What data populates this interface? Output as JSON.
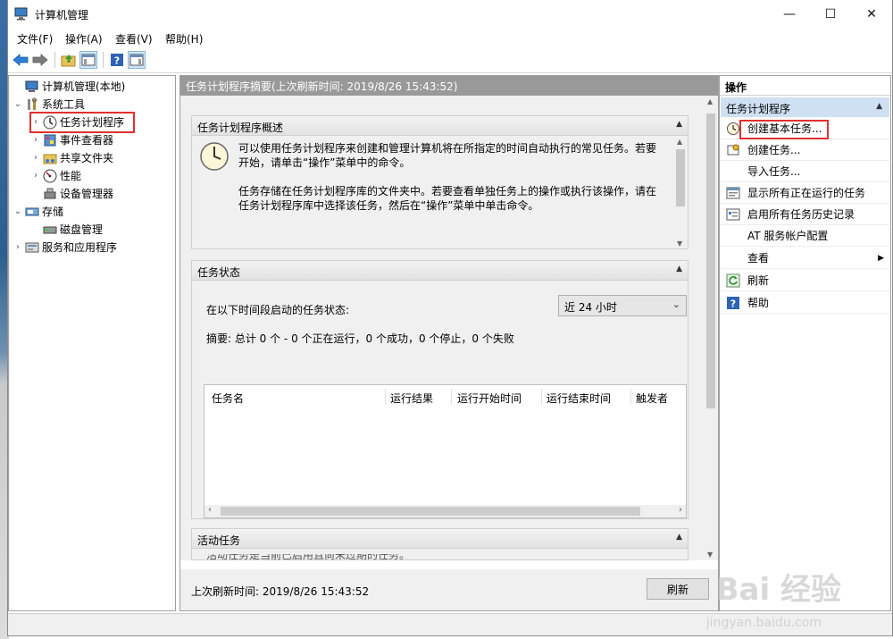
{
  "window": {
    "title": "计算机管理",
    "colors": {
      "accent_red": "#e03030",
      "header_gray": "#999999",
      "group_blue": "#cfe0f3"
    }
  },
  "window_controls": [
    "—",
    "☐",
    "✕"
  ],
  "menu": [
    {
      "label": "文件(F)"
    },
    {
      "label": "操作(A)"
    },
    {
      "label": "查看(V)"
    },
    {
      "label": "帮助(H)"
    }
  ],
  "toolbar": {
    "icons": [
      "back-arrow-icon",
      "forward-arrow-icon",
      "up-folder-icon",
      "show-hide-tree-icon",
      "help-icon",
      "show-hide-action-pane-icon"
    ]
  },
  "tree": {
    "items": [
      {
        "label": "计算机管理(本地)",
        "icon": "computer-management-icon",
        "expander": ""
      },
      {
        "label": "系统工具",
        "icon": "tools-icon",
        "expander": "⌄"
      },
      {
        "label": "任务计划程序",
        "icon": "clock-icon",
        "expander": "›"
      },
      {
        "label": "事件查看器",
        "icon": "event-viewer-icon",
        "expander": "›"
      },
      {
        "label": "共享文件夹",
        "icon": "shared-folder-icon",
        "expander": "›"
      },
      {
        "label": "性能",
        "icon": "performance-icon",
        "expander": "›"
      },
      {
        "label": "设备管理器",
        "icon": "device-manager-icon",
        "expander": ""
      },
      {
        "label": "存储",
        "icon": "storage-icon",
        "expander": "⌄"
      },
      {
        "label": "磁盘管理",
        "icon": "disk-icon",
        "expander": ""
      },
      {
        "label": "服务和应用程序",
        "icon": "services-icon",
        "expander": "›"
      }
    ]
  },
  "center": {
    "header": "任务计划程序摘要(上次刷新时间: 2019/8/26 15:43:52)",
    "overview": {
      "title": "任务计划程序概述",
      "para1_line1": "可以使用任务计划程序来创建和管理计算机将在所指定的时间自动执行的常见任务。若要",
      "para1_line2": "开始，请单击“操作”菜单中的命令。",
      "para2_line1": "任务存储在任务计划程序库的文件夹中。若要查看单独任务上的操作或执行该操作，请在",
      "para2_line2": "任务计划程序库中选择该任务，然后在“操作”菜单中单击命令。"
    },
    "status": {
      "title": "任务状态",
      "period_label": "在以下时间段启动的任务状态:",
      "period_value": "近 24 小时",
      "summary": "摘要: 总计 0 个 - 0 个正在运行，0 个成功，0 个停止，0 个失败",
      "columns": [
        "任务名",
        "运行结果",
        "运行开始时间",
        "运行结束时间",
        "触发者"
      ]
    },
    "active": {
      "title": "活动任务",
      "partial_text": "活动任务是当前已启用且尚未过期的任务。"
    },
    "footer": {
      "last_refresh": "上次刷新时间: 2019/8/26 15:43:52",
      "refresh_button": "刷新"
    }
  },
  "actions": {
    "title": "操作",
    "group": "任务计划程序",
    "items": [
      {
        "label": "创建基本任务...",
        "icon": "create-basic-task-icon"
      },
      {
        "label": "创建任务...",
        "icon": "create-task-icon"
      },
      {
        "label": "导入任务...",
        "icon": ""
      },
      {
        "label": "显示所有正在运行的任务",
        "icon": "running-tasks-icon"
      },
      {
        "label": "启用所有任务历史记录",
        "icon": "history-icon"
      },
      {
        "label": "AT 服务帐户配置",
        "icon": ""
      },
      {
        "label": "查看",
        "icon": "",
        "submenu": "▶"
      },
      {
        "label": "刷新",
        "icon": "refresh-icon"
      },
      {
        "label": "帮助",
        "icon": "help-icon"
      }
    ]
  },
  "watermark": {
    "main": "Bai 经验",
    "sub": "jingyan.baidu.com"
  }
}
